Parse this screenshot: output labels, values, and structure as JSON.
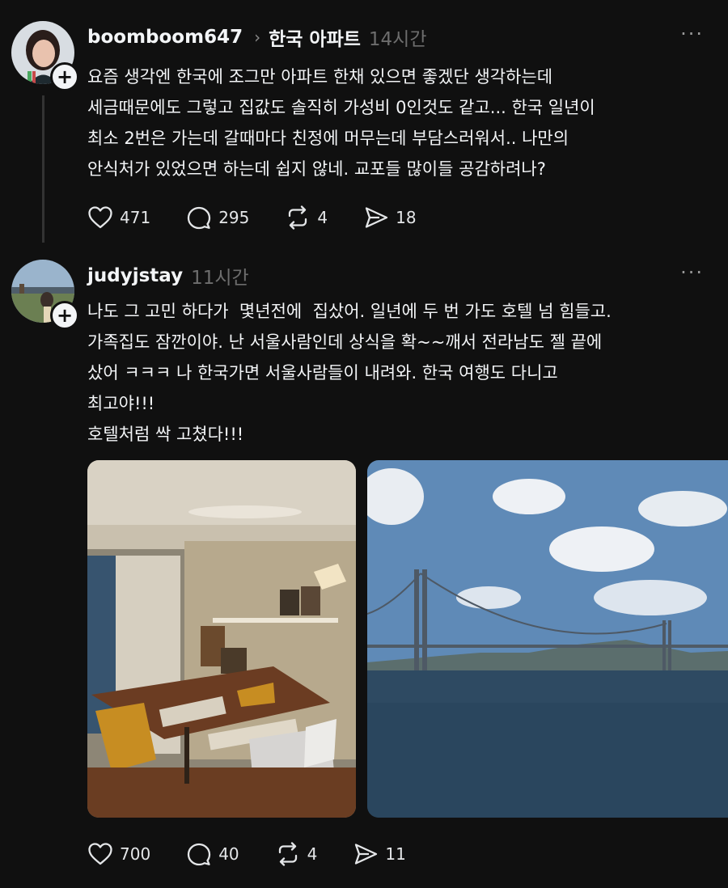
{
  "posts": [
    {
      "username": "boomboom647",
      "topic": "한국 아파트",
      "time": "14시간",
      "more": "···",
      "text": "요즘 생각엔 한국에 조그만 아파트 한채 있으면 좋겠단 생각하는데\n세금때문에도 그렇고 집값도 솔직히 가성비 0인것도 같고... 한국 일년이\n최소 2번은 가는데 갈때마다 친정에 머무는데 부담스러워서.. 나만의\n안식처가 있었으면 하는데 쉽지 않네. 교포들 많이들 공감하려나?",
      "likes": "471",
      "comments": "295",
      "reposts": "4",
      "shares": "18"
    },
    {
      "username": "judyjstay",
      "time": "11시간",
      "more": "···",
      "text": "나도 그 고민 하다가  몇년전에  집샀어. 일년에 두 번 가도 호텔 넘 힘들고.\n가족집도 잠깐이야. 난 서울사람인데 상식을 확~~깨서 전라남도 젤 끝에\n샀어 ㅋㅋㅋ 나 한국가면 서울사람들이 내려와. 한국 여행도 다니고\n최고야!!!\n호텔처럼 싹 고쳤다!!!",
      "likes": "700",
      "comments": "40",
      "reposts": "4",
      "shares": "11"
    }
  ],
  "icons": {
    "like": "heart-icon",
    "comment": "comment-icon",
    "repost": "repost-icon",
    "share": "send-icon",
    "follow": "plus-icon"
  },
  "follow_symbol": "+",
  "chevron": "›"
}
